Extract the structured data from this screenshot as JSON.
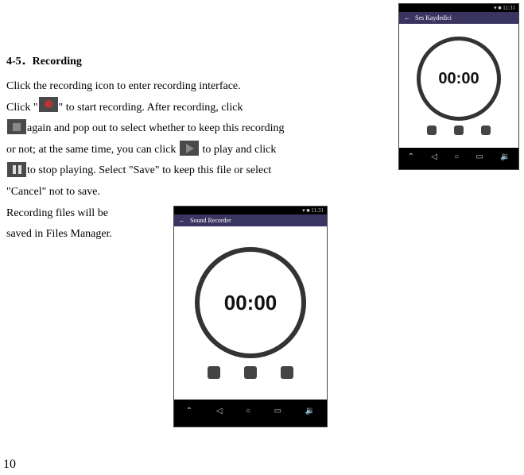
{
  "section": {
    "number": "4-5．",
    "title": "Recording"
  },
  "body": {
    "t1": "Click the recording icon to enter recording interface.",
    "t2a": "Click \"",
    "t2b": "\" to start recording. After recording, click",
    "t3": "again and pop out to select whether to keep this recording",
    "t4a": "or not; at the same time, you can click ",
    "t4b": " to play and click",
    "t5": "to stop playing. Select \"Save\" to keep this file or select",
    "t6": "\"Cancel\" not to save.",
    "t7": "Recording files will be",
    "t8": "saved in Files Manager."
  },
  "screenshots": {
    "right": {
      "app_title": "Ses Kaydedici",
      "timer": "00:00"
    },
    "center": {
      "app_title": "Sound Recorder",
      "timer": "00:00"
    }
  },
  "page_number": "10"
}
